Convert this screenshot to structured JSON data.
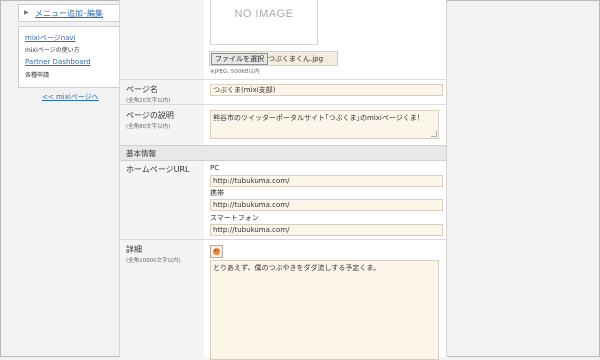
{
  "sidebar": {
    "menu_add_label": "メニュー追加･編集",
    "links": [
      {
        "label": "mixiページnavi",
        "desc": "mixiページの使い方"
      },
      {
        "label": "Partner Dashboard",
        "desc": "各種申請"
      }
    ],
    "back_link": "<< mixiページへ"
  },
  "image_section": {
    "placeholder": "NO IMAGE",
    "file_button": "ファイルを選択",
    "file_name": "つぶくまくん.jpg",
    "note": "※JPEG, 500KB以内"
  },
  "page_name": {
    "label": "ページ名",
    "sub": "(全角20文字以内)",
    "value": "つぶくま(mixi支部)"
  },
  "page_desc": {
    "label": "ページの説明",
    "sub": "(全角80文字以内)",
    "value": "熊谷市のツイッターポータルサイト｢つぶくま｣のmixiページくま！"
  },
  "basic_info": {
    "heading": "基本情報",
    "homepage_label": "ホームページURL",
    "pc_label": "PC",
    "pc_value": "http://tubukuma.com/",
    "mobile_label": "携帯",
    "mobile_value": "http://tubukuma.com/",
    "smartphone_label": "スマートフォン",
    "smartphone_value": "http://tubukuma.com/"
  },
  "details": {
    "label": "詳細",
    "sub": "(全角10000文字以内)",
    "emoji_icon": "emoji-face-icon",
    "value": "とりあえず、僕のつぶやきをダダ流しする予定くま。"
  },
  "colors": {
    "link": "#2a6fb5",
    "input_bg": "#fbf5ea",
    "section_bg": "#e8e8e8"
  }
}
